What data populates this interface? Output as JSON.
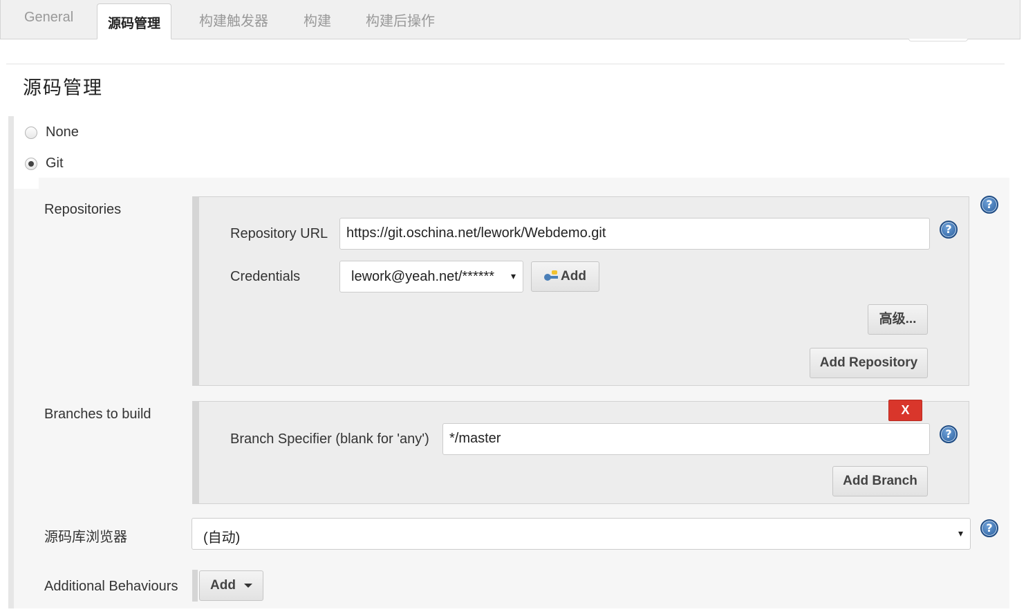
{
  "tabs": [
    {
      "label": "General"
    },
    {
      "label": "源码管理"
    },
    {
      "label": "构建触发器"
    },
    {
      "label": "构建"
    },
    {
      "label": "构建后操作"
    }
  ],
  "section_title": "源码管理",
  "scm_options": {
    "none": "None",
    "git": "Git",
    "selected": "Git"
  },
  "repositories": {
    "label": "Repositories",
    "url_label": "Repository URL",
    "url_value": "https://git.oschina.net/lework/Webdemo.git",
    "credentials_label": "Credentials",
    "credentials_value": "lework@yeah.net/******",
    "add_credentials_label": "Add",
    "advanced_label": "高级...",
    "add_repository_label": "Add Repository"
  },
  "branches": {
    "label": "Branches to build",
    "delete_label": "X",
    "specifier_label": "Branch Specifier (blank for 'any')",
    "specifier_value": "*/master",
    "add_branch_label": "Add Branch"
  },
  "repo_browser": {
    "label": "源码库浏览器",
    "value": "(自动)"
  },
  "additional_behaviours": {
    "label": "Additional Behaviours",
    "add_label": "Add"
  },
  "help_glyph": "?",
  "caret_glyph": "▾",
  "colors": {
    "accent_help": "#2a5f9e",
    "delete_red": "#d9362b"
  }
}
